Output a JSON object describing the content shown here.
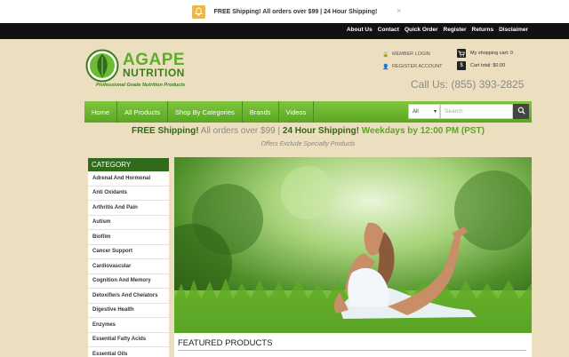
{
  "notification": {
    "text": "FREE Shipping! All orders over $99 | 24 Hour Shipping!",
    "close": "×"
  },
  "top_links": [
    "About Us",
    "Contact",
    "Quick Order",
    "Register",
    "Returns",
    "Disclaimer"
  ],
  "logo": {
    "line1": "AGAPE",
    "line2": "NUTRITION",
    "tagline": "Professional Grade Nutrition Products"
  },
  "account": {
    "login": "MEMBER LOGIN",
    "register": "REGISTER ACCOUNT"
  },
  "cart": {
    "items": "My shopping cart: 0",
    "total": "Cart total: $0.00"
  },
  "phone": "Call Us: (855) 393-2825",
  "nav": [
    "Home",
    "All Products",
    "Shop By Categories",
    "Brands",
    "Videos"
  ],
  "search": {
    "select": "All",
    "placeholder": "Search"
  },
  "promo": {
    "a": "FREE Shipping!",
    "b": " All orders over $99 ",
    "sep1": "|",
    "c": " 24 Hour Shipping!",
    "d": " Weekdays by 12:00 PM (PST)",
    "offers": "Offers Exclude Specialty Products"
  },
  "category": {
    "title": "CATEGORY",
    "items": [
      "Adrenal And Hormonal",
      "Anti Oxidants",
      "Arthritis And Pain",
      "Autism",
      "Biofilm",
      "Cancer Support",
      "Cardiovascular",
      "Cognition And Memory",
      "Detoxifiers And Chelators",
      "Digestive Health",
      "Enzymes",
      "Essential Fatty Acids",
      "Essential Oils"
    ]
  },
  "featured_title": "FEATURED PRODUCTS",
  "colors": {
    "brand_green": "#5cae2b",
    "dark_green": "#2f6b1a",
    "page_bg": "#ecdfc0"
  }
}
